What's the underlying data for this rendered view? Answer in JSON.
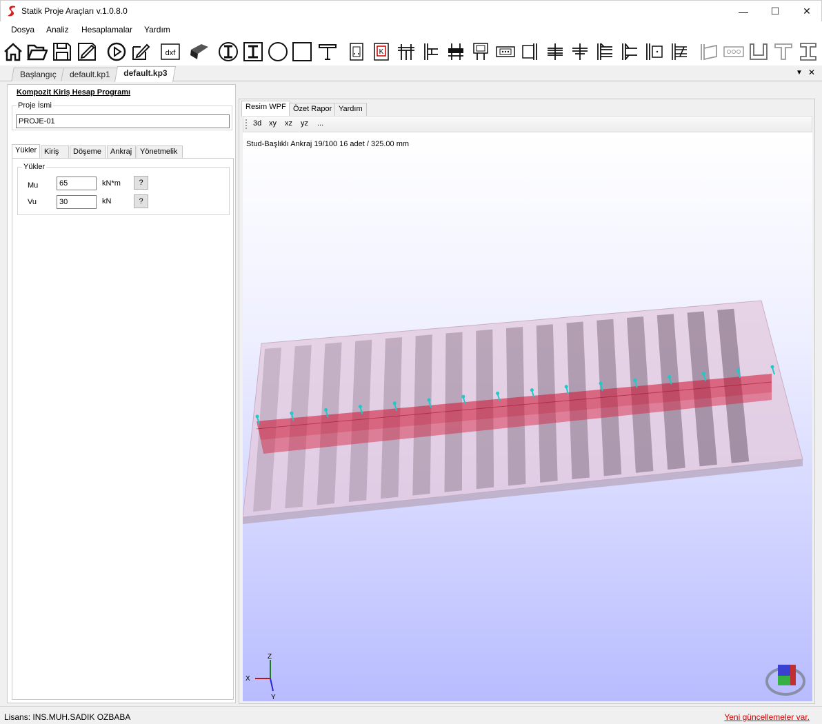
{
  "window": {
    "title": "Statik Proje Araçları v.1.0.8.0"
  },
  "menu": {
    "items": [
      "Dosya",
      "Analiz",
      "Hesaplamalar",
      "Yardım"
    ]
  },
  "toolbar": {
    "icons": [
      "home-icon",
      "open-folder-icon",
      "save-icon",
      "edit-drawing-icon",
      "run-icon",
      "edit-pencil-icon",
      "dxf-export-icon",
      "plate-3d-icon",
      "i-section-circle-icon",
      "i-section-square-icon",
      "circle-section-icon",
      "rect-section-icon",
      "t-crane-icon",
      "column-base-icon",
      "k-base-icon",
      "beam-column-icon",
      "side-connection-icon",
      "moment-connection-icon",
      "bolted-plate-icon",
      "splice-icon",
      "bracket-icon",
      "double-beam-icon",
      "beam-seat-icon",
      "end-plate-icon",
      "double-end-plate-icon",
      "stiffened-end-plate-icon",
      "stiffener-plate-icon",
      "column-wall-icon",
      "bolt-pattern-icon",
      "u-channel-icon",
      "t-section-icon",
      "i-beam-icon"
    ],
    "dxf_label": "dxf"
  },
  "doc_tabs": [
    "Başlangıç",
    "default.kp1",
    "default.kp3"
  ],
  "left": {
    "program_title": "Kompozit Kiriş Hesap Programı",
    "project_group": "Proje İsmi",
    "project_name": "PROJE-01",
    "tabs": [
      "Yükler",
      "Kiriş",
      "Döşeme",
      "Ankraj",
      "Yönetmelik"
    ],
    "loads_group": "Yükler",
    "loads": [
      {
        "label": "Mu",
        "value": "65",
        "unit": "kN*m",
        "help": "?"
      },
      {
        "label": "Vu",
        "value": "30",
        "unit": "kN",
        "help": "?"
      }
    ]
  },
  "right": {
    "tabs": [
      "Resim WPF",
      "Özet Rapor",
      "Yardım"
    ],
    "view_buttons": [
      "3d",
      "xy",
      "xz",
      "yz",
      "..."
    ],
    "info": "Stud-Başlıklı Ankraj 19/100  16 adet / 325.00 mm",
    "axes": {
      "z": "Z",
      "x": "X",
      "y": "Y"
    },
    "stud_count": 16,
    "colors": {
      "beam": "#d01030",
      "studs": "#20c8c8",
      "slab": "#e6c8dc",
      "deck": "#7a6a7a"
    }
  },
  "status": {
    "license": "Lisans: INS.MUH.SADIK OZBABA",
    "update": "Yeni güncellemeler var."
  }
}
